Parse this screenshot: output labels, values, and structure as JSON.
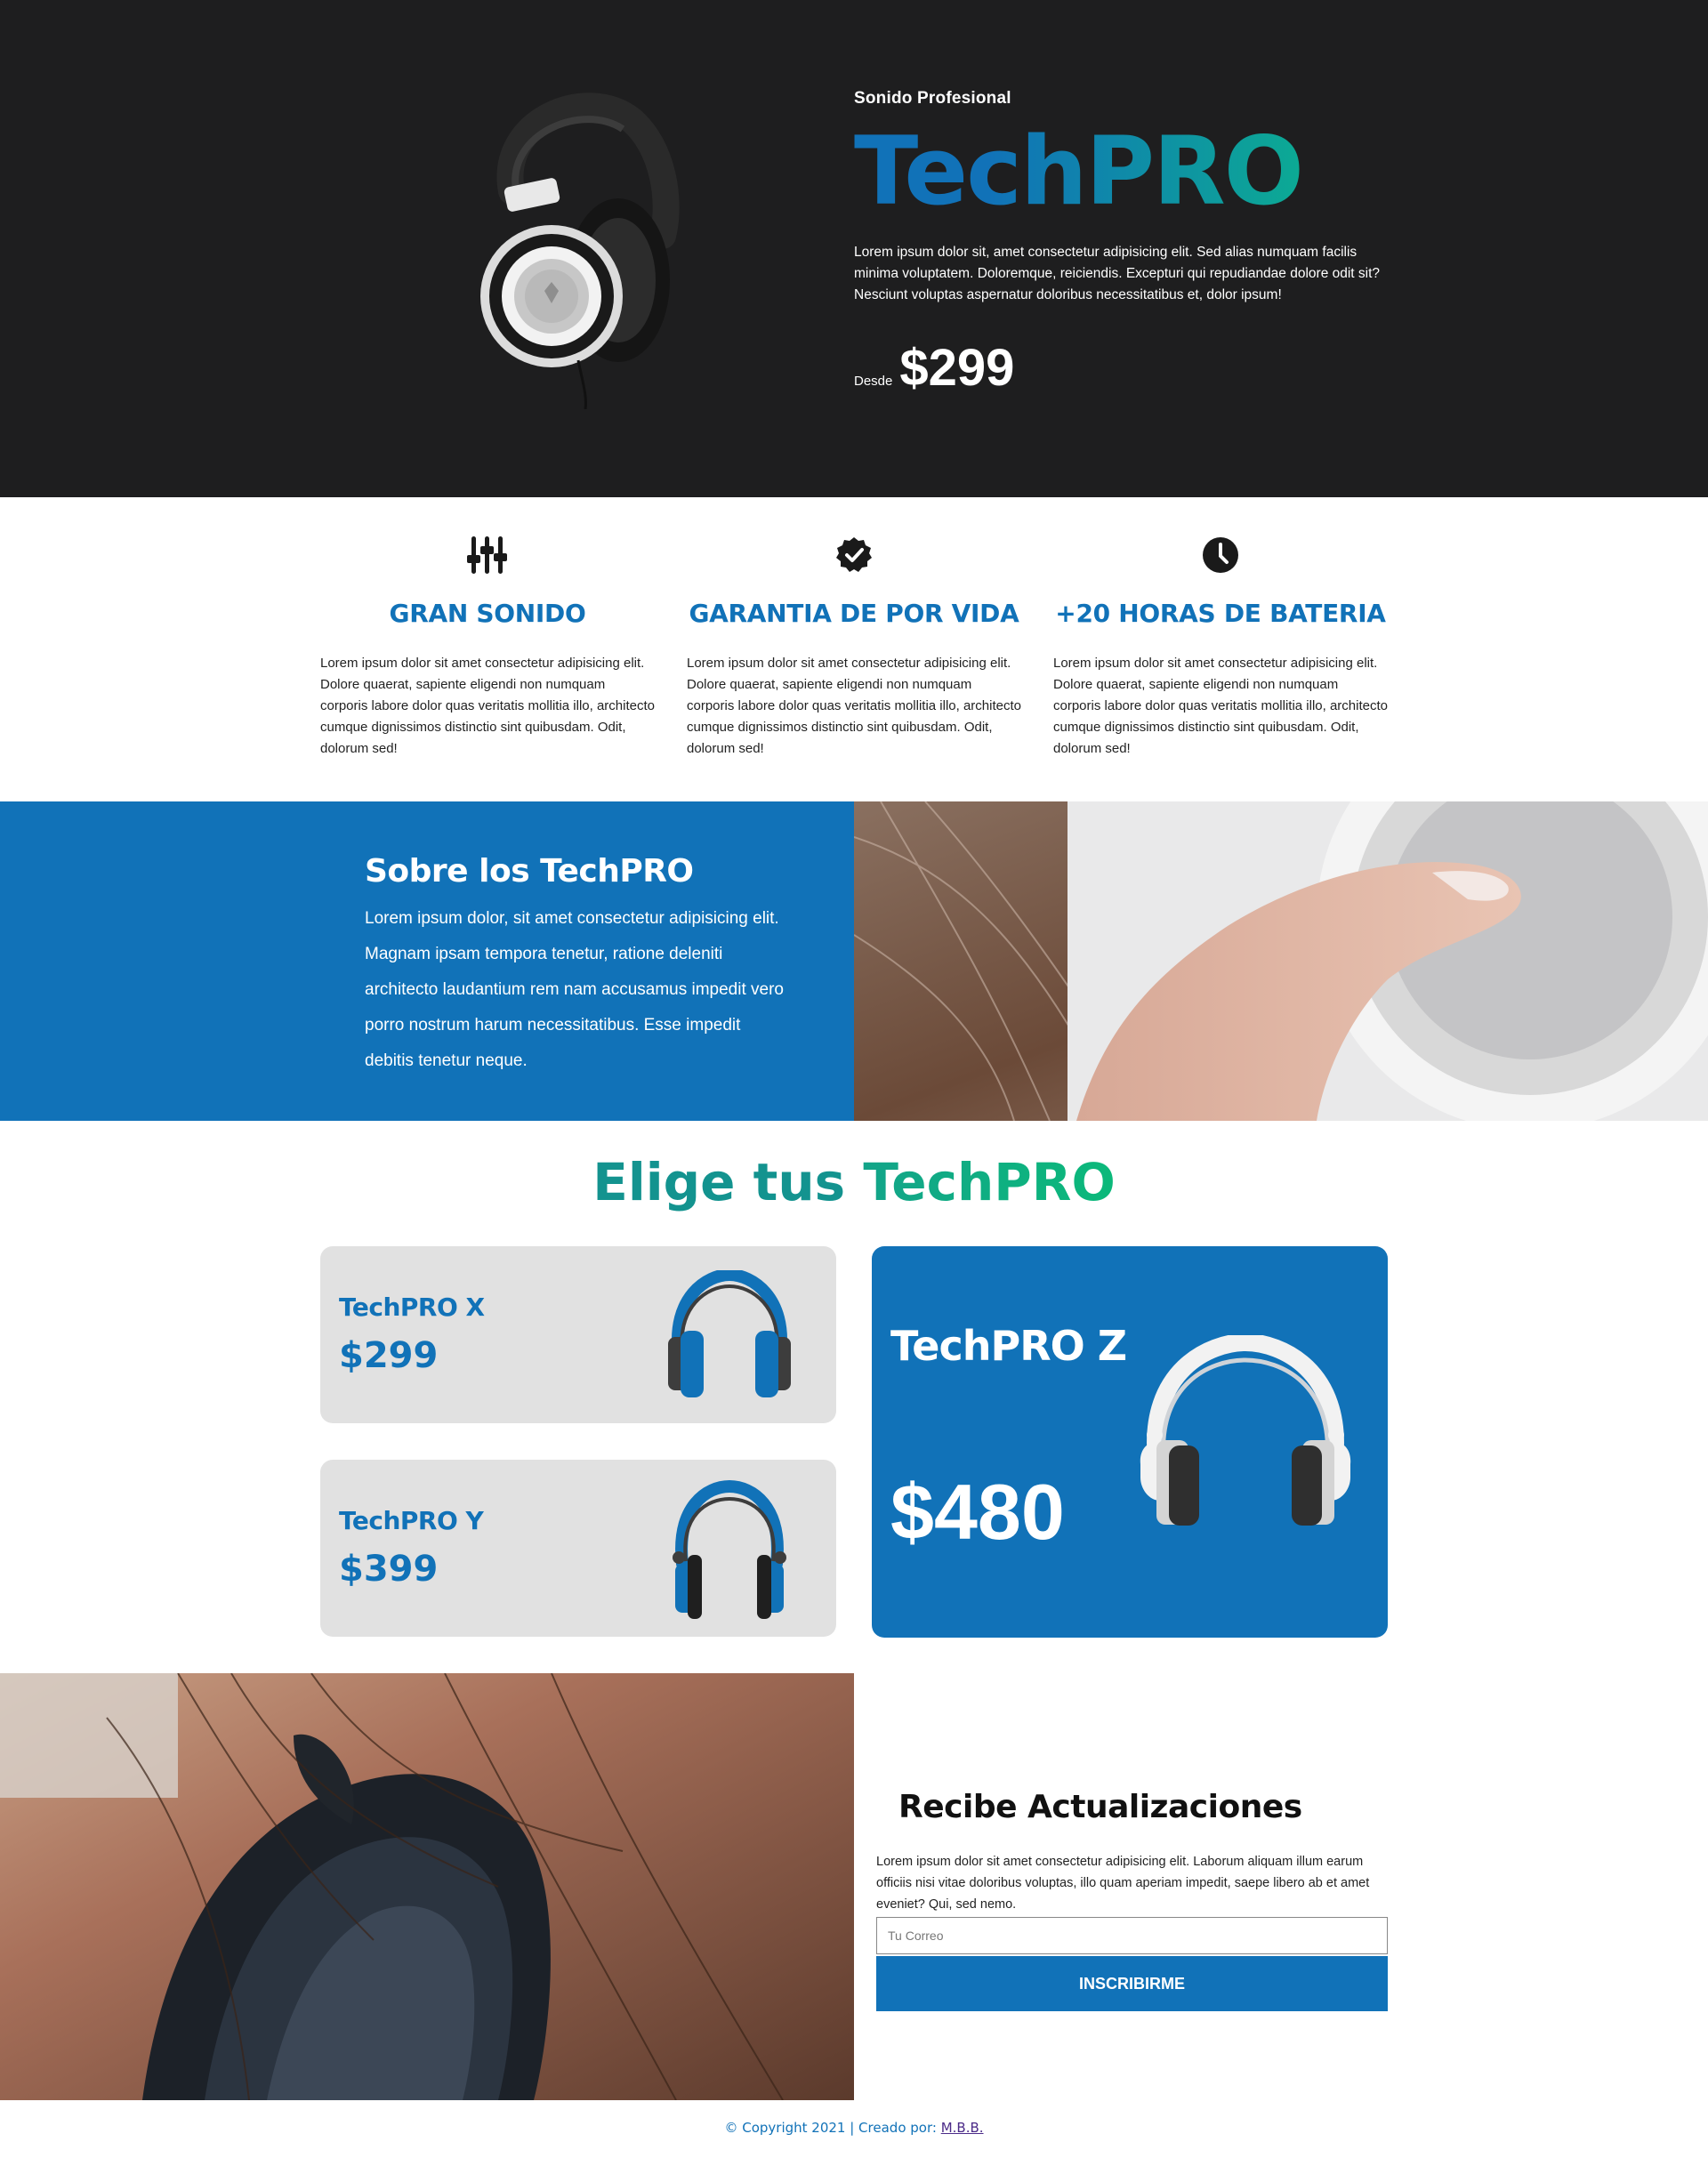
{
  "hero": {
    "tag": "Sonido Profesional",
    "title": "TechPRO",
    "description": "Lorem ipsum dolor sit, amet consectetur adipisicing elit. Sed alias numquam facilis minima voluptatem. Doloremque, reiciendis. Excepturi qui repudiandae dolore odit sit? Nesciunt voluptas aspernatur doloribus necessitatibus et, dolor ipsum!",
    "price_prefix": "Desde",
    "price": "$299"
  },
  "features": [
    {
      "icon": "sliders-icon",
      "title": "GRAN SONIDO",
      "text": "Lorem ipsum dolor sit amet consectetur adipisicing elit. Dolore quaerat, sapiente eligendi non numquam corporis labore dolor quas veritatis mollitia illo, architecto cumque dignissimos distinctio sint quibusdam. Odit, dolorum sed!"
    },
    {
      "icon": "badge-check-icon",
      "title": "GARANTIA DE POR VIDA",
      "text": "Lorem ipsum dolor sit amet consectetur adipisicing elit. Dolore quaerat, sapiente eligendi non numquam corporis labore dolor quas veritatis mollitia illo, architecto cumque dignissimos distinctio sint quibusdam. Odit, dolorum sed!"
    },
    {
      "icon": "clock-icon",
      "title": "+20 HORAS DE BATERIA",
      "text": "Lorem ipsum dolor sit amet consectetur adipisicing elit. Dolore quaerat, sapiente eligendi non numquam corporis labore dolor quas veritatis mollitia illo, architecto cumque dignissimos distinctio sint quibusdam. Odit, dolorum sed!"
    }
  ],
  "about": {
    "title": "Sobre los TechPRO",
    "text": "Lorem ipsum dolor, sit amet consectetur adipisicing elit. Magnam ipsam tempora tenetur, ratione deleniti architecto laudantium rem nam accusamus impedit vero porro nostrum harum necessitatibus. Esse impedit debitis tenetur neque."
  },
  "choose": {
    "title_part1": "Elige tus",
    "title_part2": "TechPRO",
    "products": [
      {
        "name": "TechPRO X",
        "price": "$299"
      },
      {
        "name": "TechPRO Y",
        "price": "$399"
      },
      {
        "name": "TechPRO Z",
        "price": "$480"
      }
    ]
  },
  "newsletter": {
    "title": "Recibe Actualizaciones",
    "text": "Lorem ipsum dolor sit amet consectetur adipisicing elit. Laborum aliquam illum earum officiis nisi vitae doloribus voluptas, illo quam aperiam impedit, saepe libero ab et amet eveniet? Qui, sed nemo.",
    "placeholder": "Tu Correo",
    "button": "INSCRIBIRME"
  },
  "footer": {
    "text": "© Copyright 2021 | Creado por:",
    "author": "M.B.B."
  },
  "colors": {
    "primary": "#1172b8",
    "green": "#0bb98a",
    "dark": "#1e1e1f",
    "card_bg": "#e1e1e1"
  }
}
